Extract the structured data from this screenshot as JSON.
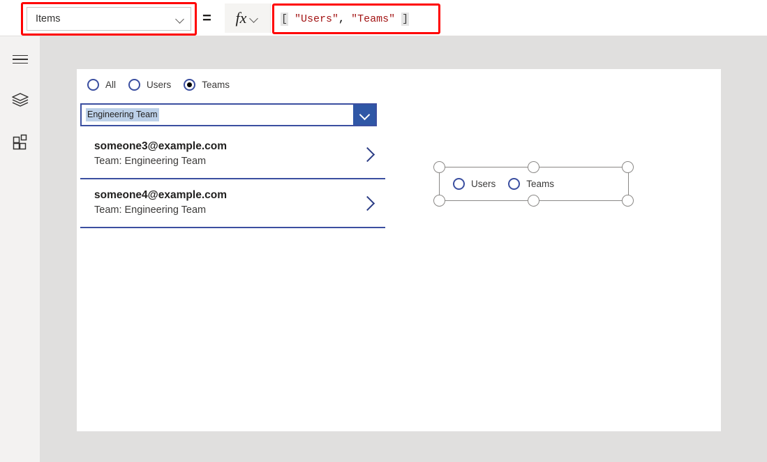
{
  "toolbar": {
    "property_label": "Items",
    "equals": "=",
    "fx_label": "fx",
    "formula": {
      "open_bracket": "[",
      "string1": "\"Users\"",
      "comma": ", ",
      "string2": "\"Teams\"",
      "close_bracket": "]"
    }
  },
  "sidebar": {
    "items": [
      {
        "name": "menu",
        "label": "Menu"
      },
      {
        "name": "tree-view",
        "label": "Tree view"
      },
      {
        "name": "insert",
        "label": "Insert"
      }
    ]
  },
  "screen": {
    "radio_group": {
      "options": [
        {
          "label": "All",
          "selected": false
        },
        {
          "label": "Users",
          "selected": false
        },
        {
          "label": "Teams",
          "selected": true
        }
      ]
    },
    "dropdown": {
      "value": "Engineering Team"
    },
    "gallery": {
      "rows": [
        {
          "title": "someone3@example.com",
          "subtitle": "Team: Engineering Team"
        },
        {
          "title": "someone4@example.com",
          "subtitle": "Team: Engineering Team"
        }
      ]
    }
  },
  "selected_control": {
    "options": [
      {
        "label": "Users",
        "selected": false
      },
      {
        "label": "Teams",
        "selected": false
      }
    ]
  },
  "colors": {
    "accent_navy": "#3b4fa0",
    "dropdown_button": "#2f57a6",
    "selection_highlight": "#bcd0e8",
    "annotation_red": "#ff0000",
    "formula_string": "#a31515",
    "canvas_background": "#e0dfde"
  }
}
